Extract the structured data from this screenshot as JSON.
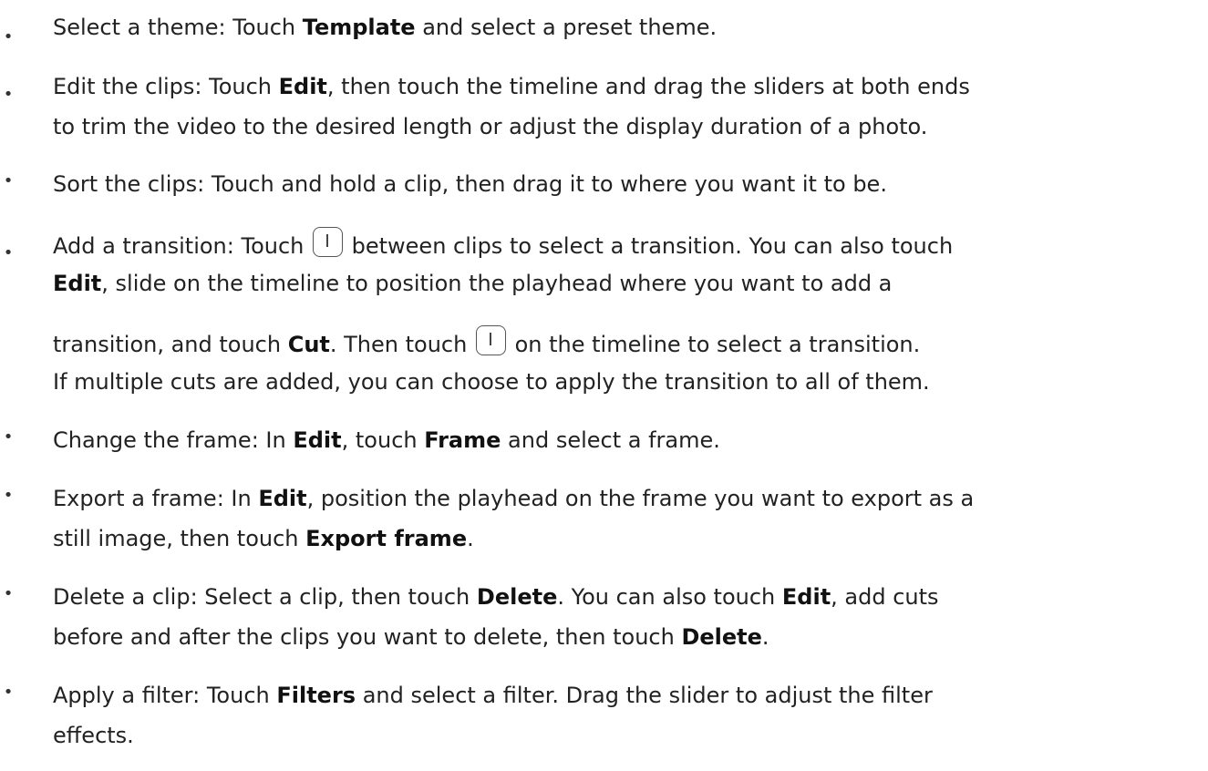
{
  "bullet_char": "•",
  "icons": {
    "transition_button": "transition-button-icon"
  },
  "items": [
    {
      "lines": [
        [
          {
            "t": "Select a theme: Touch "
          },
          {
            "t": "Template",
            "b": true
          },
          {
            "t": " and select a preset theme."
          }
        ]
      ]
    },
    {
      "lines": [
        [
          {
            "t": "Edit the clips: Touch "
          },
          {
            "t": "Edit",
            "b": true
          },
          {
            "t": ", then touch the timeline and drag the sliders at both ends"
          }
        ],
        [
          {
            "t": "to trim the video to the desired length or adjust the display duration of a photo."
          }
        ]
      ]
    },
    {
      "lines": [
        [
          {
            "t": "Sort the clips: Touch and hold a clip, then drag it to where you want it to be."
          }
        ]
      ]
    },
    {
      "lines": [
        [
          {
            "t": "Add a transition: Touch "
          },
          {
            "icon": "transition-button-icon"
          },
          {
            "t": " between clips to select a transition. You can also touch"
          }
        ],
        [
          {
            "t": "Edit",
            "b": true
          },
          {
            "t": ", slide on the timeline to position the playhead where you want to add a"
          }
        ],
        [
          {
            "t": "transition, and touch "
          },
          {
            "t": "Cut",
            "b": true
          },
          {
            "t": ". Then touch "
          },
          {
            "icon": "transition-button-icon"
          },
          {
            "t": " on the timeline to select a transition."
          }
        ],
        [
          {
            "t": "If multiple cuts are added, you can choose to apply the transition to all of them."
          }
        ]
      ]
    },
    {
      "lines": [
        [
          {
            "t": "Change the frame: In "
          },
          {
            "t": "Edit",
            "b": true
          },
          {
            "t": ", touch "
          },
          {
            "t": "Frame",
            "b": true
          },
          {
            "t": " and select a frame."
          }
        ]
      ]
    },
    {
      "lines": [
        [
          {
            "t": "Export a frame: In "
          },
          {
            "t": "Edit",
            "b": true
          },
          {
            "t": ", position the playhead on the frame you want to export as a"
          }
        ],
        [
          {
            "t": "still image, then touch "
          },
          {
            "t": "Export frame",
            "b": true
          },
          {
            "t": "."
          }
        ]
      ]
    },
    {
      "lines": [
        [
          {
            "t": "Delete a clip: Select a clip, then touch "
          },
          {
            "t": "Delete",
            "b": true
          },
          {
            "t": ". You can also touch "
          },
          {
            "t": "Edit",
            "b": true
          },
          {
            "t": ", add cuts"
          }
        ],
        [
          {
            "t": "before and after the clips you want to delete, then touch "
          },
          {
            "t": "Delete",
            "b": true
          },
          {
            "t": "."
          }
        ]
      ]
    },
    {
      "lines": [
        [
          {
            "t": "Apply a filter: Touch "
          },
          {
            "t": "Filters",
            "b": true
          },
          {
            "t": " and select a filter. Drag the slider to adjust the filter"
          }
        ],
        [
          {
            "t": "effects."
          }
        ]
      ]
    }
  ]
}
